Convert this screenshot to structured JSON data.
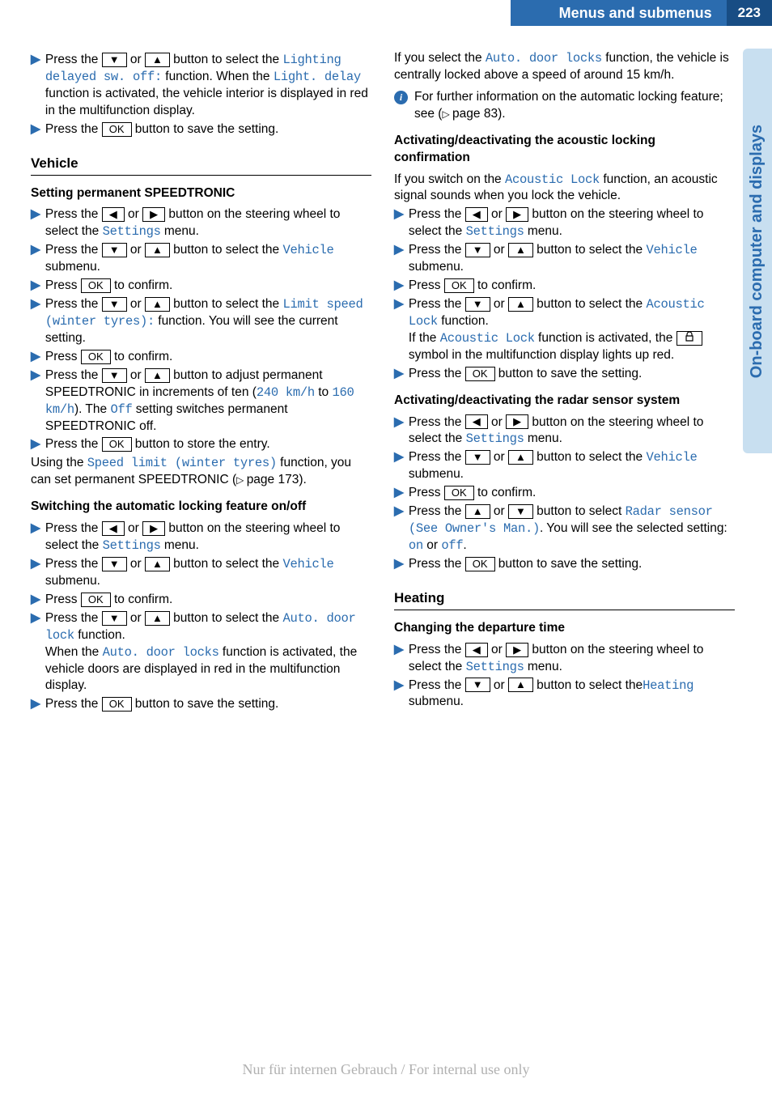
{
  "header": {
    "title": "Menus and submenus",
    "page": "223"
  },
  "sidetab": "On-board computer and displays",
  "footer": "Nur für internen Gebrauch / For internal use only",
  "btn": {
    "ok": "OK"
  },
  "xref": {
    "page83": "page 83",
    "page173": "page 173"
  },
  "left": {
    "s1a": "Press the ",
    "s1b": " or ",
    "s1c": " button to select the ",
    "s1d": "Lighting delayed sw. off:",
    "s1e": " function. When the ",
    "s1f": "Light. delay",
    "s1g": " function is activated, the vehicle interior is displayed in red in the multifunction display.",
    "s2a": "Press the ",
    "s2b": " button to save the setting.",
    "h_vehicle": "Vehicle",
    "h_speedtronic": "Setting permanent SPEEDTRONIC",
    "sp1a": "Press the ",
    "sp1b": " or ",
    "sp1c": " button on the steering wheel to select the ",
    "sp1d": "Settings",
    "sp1e": " menu.",
    "sp2a": "Press the ",
    "sp2b": " or ",
    "sp2c": " button to select the ",
    "sp2d": "Vehicle",
    "sp2e": " submenu.",
    "sp3a": "Press ",
    "sp3b": " to confirm.",
    "sp4a": "Press the ",
    "sp4b": " or ",
    "sp4c": " button to select the ",
    "sp4d": "Limit speed (winter tyres):",
    "sp4e": " function. You will see the current setting.",
    "sp5a": "Press ",
    "sp5b": " to confirm.",
    "sp6a": "Press the ",
    "sp6b": " or ",
    "sp6c": " button to adjust permanent SPEEDTRONIC in increments of ten (",
    "sp6d": "240 km/h",
    "sp6e": " to ",
    "sp6f": "160 km/h",
    "sp6g": "). The ",
    "sp6h": "Off",
    "sp6i": " setting switches permanent SPEEDTRONIC off.",
    "sp7a": "Press the ",
    "sp7b": " button to store the entry.",
    "sp_para_a": "Using the ",
    "sp_para_b": "Speed limit (winter tyres)",
    "sp_para_c": " function, you can set permanent SPEEDTRONIC (",
    "sp_para_d": ").",
    "h_autolock": "Switching the automatic locking feature on/off",
    "al1a": "Press the ",
    "al1b": " or ",
    "al1c": " button on the steering wheel to select the ",
    "al1d": "Settings",
    "al1e": " menu.",
    "al2a": "Press the ",
    "al2b": " or ",
    "al2c": " button to select the ",
    "al2d": "Vehicle",
    "al2e": " submenu.",
    "al3a": "Press ",
    "al3b": " to confirm.",
    "al4a": "Press the ",
    "al4b": " or ",
    "al4c": " button to select the ",
    "al4d": "Auto. door lock",
    "al4e": " function.",
    "al4f": "When the ",
    "al4g": "Auto. door locks",
    "al4h": " function is activated, the vehicle doors are displayed in red in the multifunction display.",
    "al5a": "Press the ",
    "al5b": " button to save the setting."
  },
  "right": {
    "adl_a": "If you select the ",
    "adl_b": "Auto. door locks",
    "adl_c": " function, the vehicle is centrally locked above a speed of around 15 km/h.",
    "info_a": "For further information on the automatic locking feature; see (",
    "info_b": ").",
    "h_acoustic": "Activating/deactivating the acoustic locking confirmation",
    "ac_para_a": "If you switch on the ",
    "ac_para_b": "Acoustic Lock",
    "ac_para_c": " function, an acoustic signal sounds when you lock the vehicle.",
    "ac1a": "Press the ",
    "ac1b": " or ",
    "ac1c": " button on the steering wheel to select the ",
    "ac1d": "Settings",
    "ac1e": " menu.",
    "ac2a": "Press the ",
    "ac2b": " or ",
    "ac2c": " button to select the ",
    "ac2d": "Vehicle",
    "ac2e": " submenu.",
    "ac3a": "Press ",
    "ac3b": " to confirm.",
    "ac4a": "Press the ",
    "ac4b": " or ",
    "ac4c": " button to select the ",
    "ac4d": "Acoustic Lock",
    "ac4e": " function.",
    "ac4f": "If the ",
    "ac4g": "Acoustic Lock",
    "ac4h": " function is activated, the ",
    "ac4i": " symbol in the multifunction display lights up red.",
    "ac5a": "Press the ",
    "ac5b": " button to save the setting.",
    "h_radar": "Activating/deactivating the radar sensor system",
    "ra1a": "Press the ",
    "ra1b": " or ",
    "ra1c": " button on the steering wheel to select the ",
    "ra1d": "Settings",
    "ra1e": " menu.",
    "ra2a": "Press the ",
    "ra2b": " or ",
    "ra2c": " button to select the ",
    "ra2d": "Vehicle",
    "ra2e": " submenu.",
    "ra3a": "Press ",
    "ra3b": " to confirm.",
    "ra4a": "Press the ",
    "ra4b": " or ",
    "ra4c": " button to select ",
    "ra4d": "Radar sensor (See Owner's Man.)",
    "ra4e": ". You will see the selected setting: ",
    "ra4f": "on",
    "ra4g": " or ",
    "ra4h": "off",
    "ra4i": ".",
    "ra5a": "Press the ",
    "ra5b": " button to save the setting.",
    "h_heating": "Heating",
    "h_departure": "Changing the departure time",
    "he1a": "Press the ",
    "he1b": " or ",
    "he1c": " button on the steering wheel to select the ",
    "he1d": "Settings",
    "he1e": " menu.",
    "he2a": "Press the ",
    "he2b": " or ",
    "he2c": " button to select the",
    "he2d": "Heating",
    "he2e": " submenu."
  }
}
